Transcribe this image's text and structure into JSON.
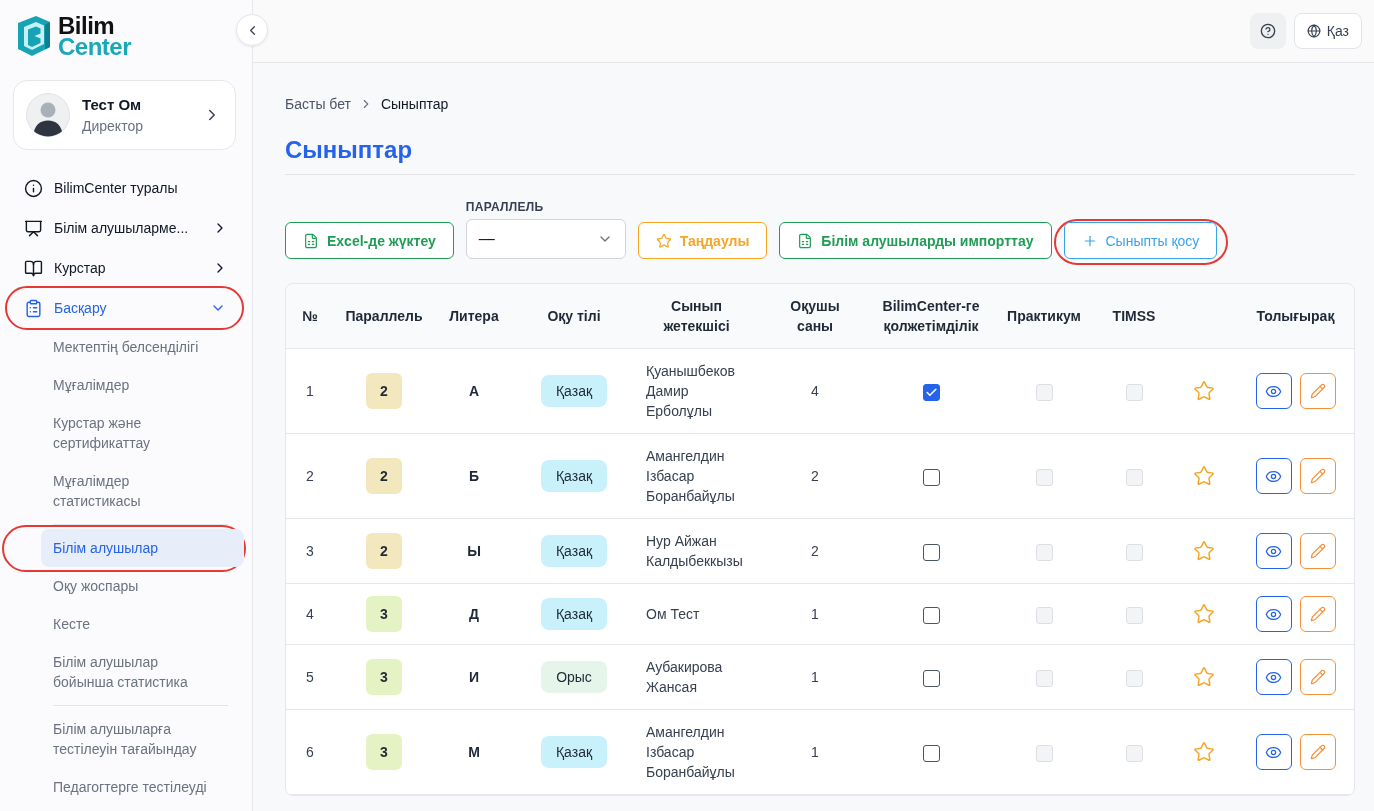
{
  "logo": {
    "line1": "Bilim",
    "line2": "Center"
  },
  "profile": {
    "name": "Тест Ом",
    "role": "Директор"
  },
  "nav": [
    {
      "kind": "link",
      "label": "BilimCenter туралы",
      "selected": false,
      "highlighted": false
    },
    {
      "kind": "menu",
      "label": "Білім алушыларме...",
      "selected": false,
      "expanded": false,
      "highlighted": false
    },
    {
      "kind": "menu",
      "label": "Курстар",
      "selected": false,
      "expanded": false,
      "highlighted": false
    },
    {
      "kind": "menu",
      "label": "Басқару",
      "selected": true,
      "expanded": true,
      "highlighted": true,
      "sections": [
        {
          "items": [
            {
              "label": "Мектептің белсенділігі",
              "selected": false,
              "highlighted": false
            },
            {
              "label": "Мұғалімдер",
              "selected": false,
              "highlighted": false
            },
            {
              "label": "Курстар және сертификаттау",
              "selected": false,
              "highlighted": false
            },
            {
              "label": "Мұғалімдер статистикасы",
              "selected": false,
              "highlighted": false
            }
          ]
        },
        {
          "items": [
            {
              "label": "Білім алушылар",
              "selected": true,
              "highlighted": true
            },
            {
              "label": "Оқу жоспары",
              "selected": false,
              "highlighted": false
            },
            {
              "label": "Кесте",
              "selected": false,
              "highlighted": false
            },
            {
              "label": "Білім алушылар бойынша статистика",
              "selected": false,
              "highlighted": false
            }
          ]
        },
        {
          "items": [
            {
              "label": "Білім алушыларға тестілеуін тағайындау",
              "selected": false,
              "highlighted": false
            },
            {
              "label": "Педагогтерге тестілеуді",
              "selected": false,
              "highlighted": false
            }
          ]
        }
      ]
    }
  ],
  "topbar": {
    "language": "Қаз"
  },
  "breadcrumb": [
    "Басты бет",
    "Сыныптар"
  ],
  "title": "Сыныптар",
  "toolbar": [
    {
      "kind": "export",
      "label": "Excel-де жүктеу",
      "color": "#1f9d55",
      "highlighted": false
    },
    {
      "kind": "select",
      "label": "ПАРАЛЛЕЛЬ",
      "value": "—",
      "highlighted": false
    },
    {
      "kind": "favorites",
      "label": "Таңдаулы",
      "color": "#f5a524",
      "highlighted": false
    },
    {
      "kind": "import",
      "label": "Білім алушыларды импорттау",
      "color": "#1f9d55",
      "highlighted": false
    },
    {
      "kind": "add",
      "label": "Сыныпты қосу",
      "color": "#38a3e8",
      "highlighted": true
    }
  ],
  "table": {
    "columns": [
      {
        "kind": "number",
        "label": "№"
      },
      {
        "kind": "parallel",
        "label": "Параллель"
      },
      {
        "kind": "letter",
        "label": "Литера"
      },
      {
        "kind": "language",
        "label": "Оқу тілі"
      },
      {
        "kind": "teacher",
        "label": "Сынып жетекшісі"
      },
      {
        "kind": "students",
        "label": "Оқушы саны"
      },
      {
        "kind": "access",
        "label": "BilimCenter-ге қолжетімділік"
      },
      {
        "kind": "practicum",
        "label": "Практикум"
      },
      {
        "kind": "timss",
        "label": "TIMSS"
      },
      {
        "kind": "favorite"
      },
      {
        "kind": "actions",
        "label": "Толығырақ"
      }
    ],
    "rows": [
      {
        "number": "1",
        "parallel": {
          "text": "2",
          "color": "#f3e8bd"
        },
        "letter": "А",
        "language": {
          "text": "Қазақ",
          "color": "#c8f1fc"
        },
        "teacher": "Қуанышбеков Дамир Ерболұлы",
        "students": "4",
        "access": {
          "checked": true,
          "disabled": false
        },
        "practicum": {
          "checked": false,
          "disabled": true
        },
        "timss": {
          "checked": false,
          "disabled": true
        },
        "favorite": false
      },
      {
        "number": "2",
        "parallel": {
          "text": "2",
          "color": "#f3e8bd"
        },
        "letter": "Б",
        "language": {
          "text": "Қазақ",
          "color": "#c8f1fc"
        },
        "teacher": "Амангелдин Ізбасар Боранбайұлы",
        "students": "2",
        "access": {
          "checked": false,
          "disabled": false
        },
        "practicum": {
          "checked": false,
          "disabled": true
        },
        "timss": {
          "checked": false,
          "disabled": true
        },
        "favorite": false
      },
      {
        "number": "3",
        "parallel": {
          "text": "2",
          "color": "#f3e8bd"
        },
        "letter": "Ы",
        "language": {
          "text": "Қазақ",
          "color": "#c8f1fc"
        },
        "teacher": "Нур Айжан Калдыбеккызы",
        "students": "2",
        "access": {
          "checked": false,
          "disabled": false
        },
        "practicum": {
          "checked": false,
          "disabled": true
        },
        "timss": {
          "checked": false,
          "disabled": true
        },
        "favorite": false
      },
      {
        "number": "4",
        "parallel": {
          "text": "3",
          "color": "#e5f2c3"
        },
        "letter": "Д",
        "language": {
          "text": "Қазақ",
          "color": "#c8f1fc"
        },
        "teacher": "Ом Тест",
        "students": "1",
        "access": {
          "checked": false,
          "disabled": false
        },
        "practicum": {
          "checked": false,
          "disabled": true
        },
        "timss": {
          "checked": false,
          "disabled": true
        },
        "favorite": false
      },
      {
        "number": "5",
        "parallel": {
          "text": "3",
          "color": "#e5f2c3"
        },
        "letter": "И",
        "language": {
          "text": "Орыс",
          "color": "#e6f5e9"
        },
        "teacher": "Аубакирова Жансая",
        "students": "1",
        "access": {
          "checked": false,
          "disabled": false
        },
        "practicum": {
          "checked": false,
          "disabled": true
        },
        "timss": {
          "checked": false,
          "disabled": true
        },
        "favorite": false
      },
      {
        "number": "6",
        "parallel": {
          "text": "3",
          "color": "#e5f2c3"
        },
        "letter": "М",
        "language": {
          "text": "Қазақ",
          "color": "#c8f1fc"
        },
        "teacher": "Амангелдин Ізбасар Боранбайұлы",
        "students": "1",
        "access": {
          "checked": false,
          "disabled": false
        },
        "practicum": {
          "checked": false,
          "disabled": true
        },
        "timss": {
          "checked": false,
          "disabled": true
        },
        "favorite": false
      }
    ]
  }
}
